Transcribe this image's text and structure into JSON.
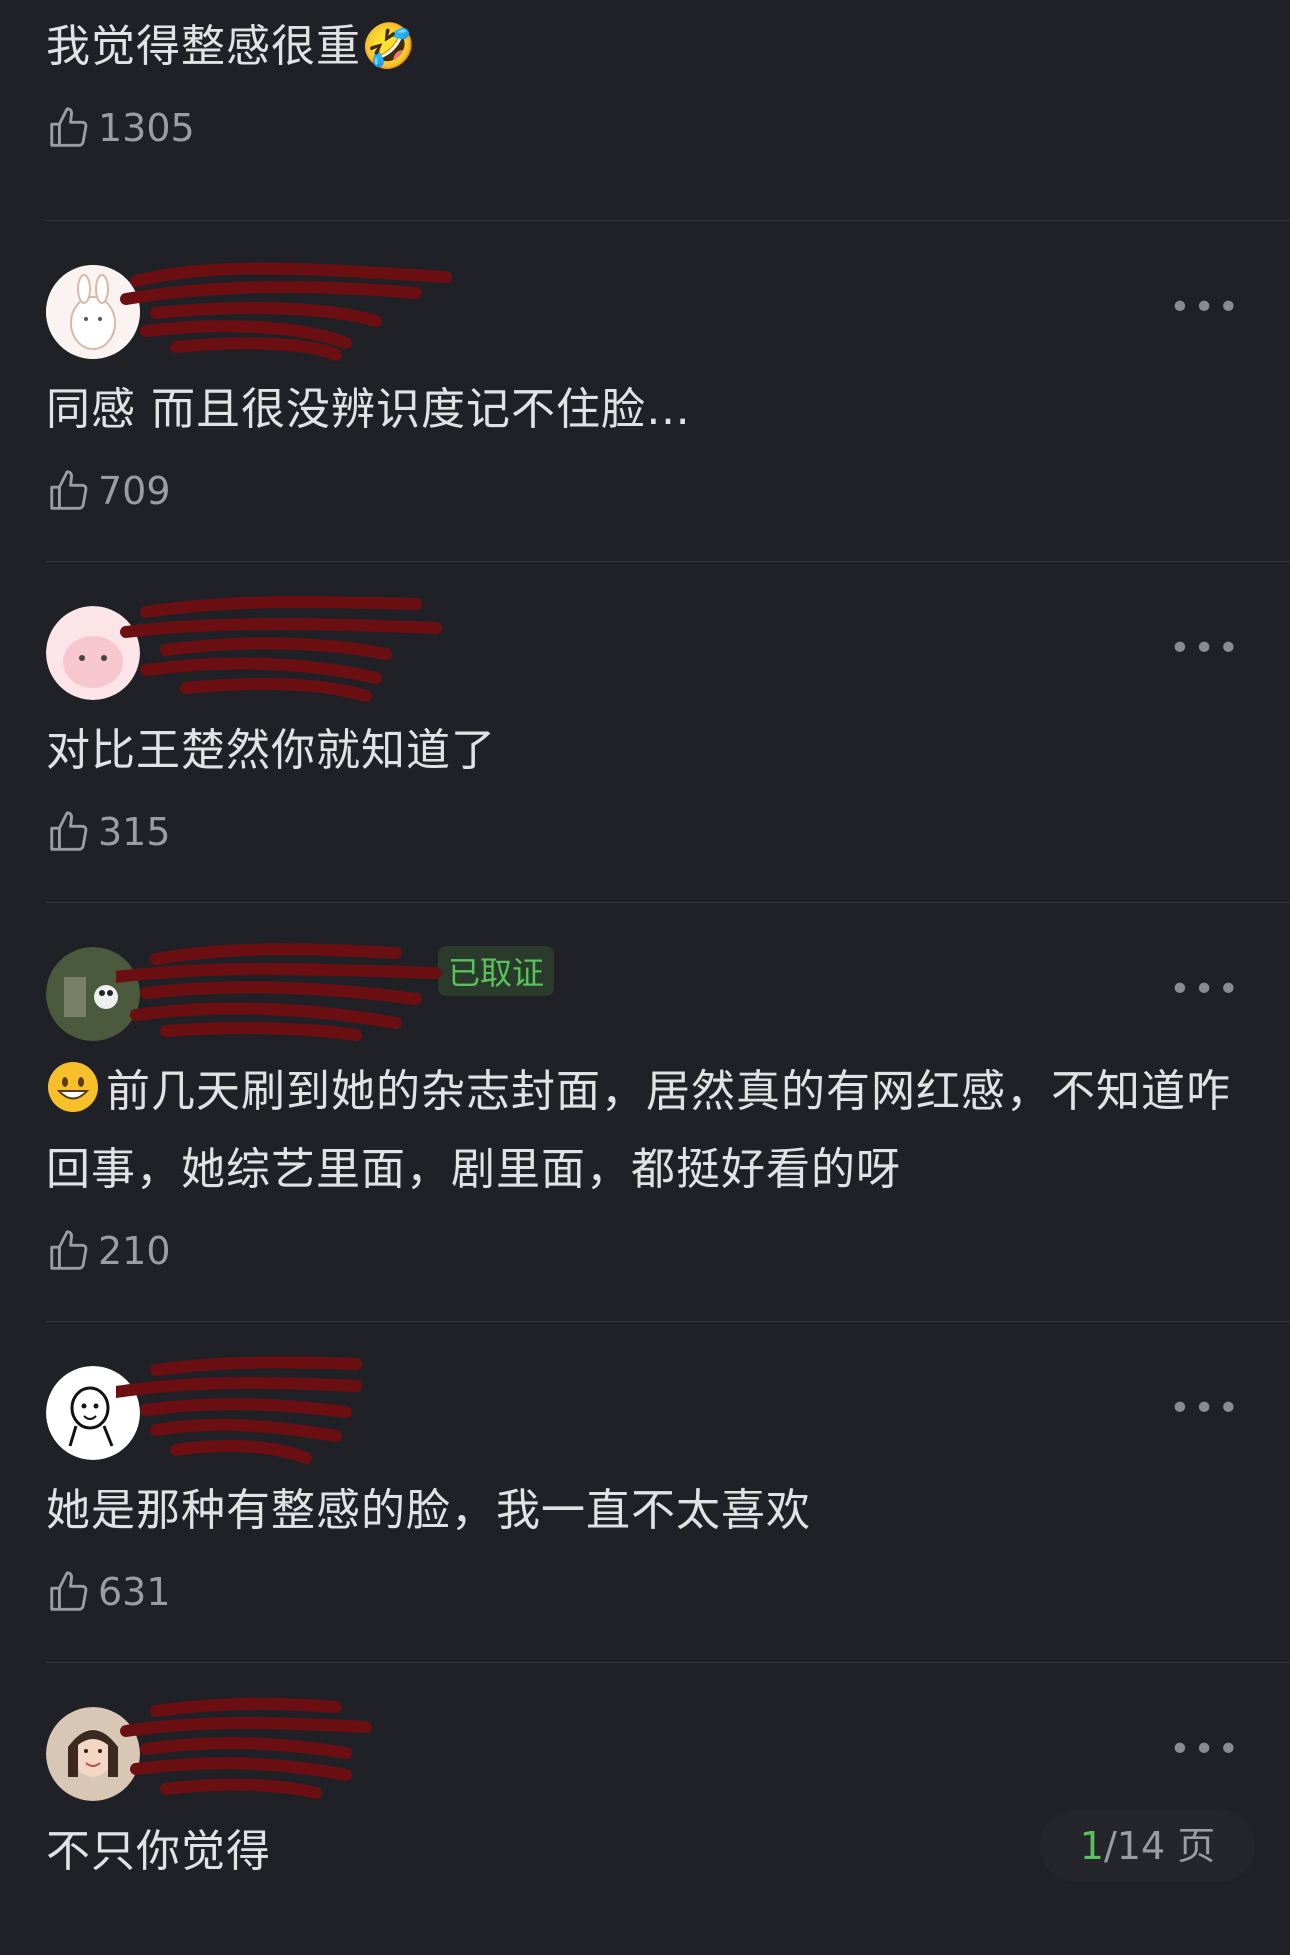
{
  "comments": [
    {
      "text": "我觉得整感很重🤣",
      "likes": "1305"
    },
    {
      "username": "",
      "badge": "",
      "time_location": "",
      "text": "同感 而且很没辨识度记不住脸…",
      "likes": "709"
    },
    {
      "username": "",
      "badge": "",
      "time_location": "",
      "text": "对比王楚然你就知道了",
      "likes": "315"
    },
    {
      "username": "",
      "badge": "已取证",
      "time_location": "",
      "text": "前几天刷到她的杂志封面，居然真的有网红感，不知道咋回事，她综艺里面，剧里面，都挺好看的呀",
      "likes": "210"
    },
    {
      "username": "",
      "badge": "",
      "time_location": "",
      "text": "她是那种有整感的脸，我一直不太喜欢",
      "likes": "631"
    },
    {
      "username": "",
      "badge": "",
      "time_location": "",
      "text": "不只你觉得"
    }
  ],
  "pager": {
    "current": "1",
    "rest": "/14 页"
  },
  "more_label": "•••",
  "colors": {
    "background": "#202126",
    "accent": "#58c25c",
    "redaction": "#6b0f12"
  }
}
